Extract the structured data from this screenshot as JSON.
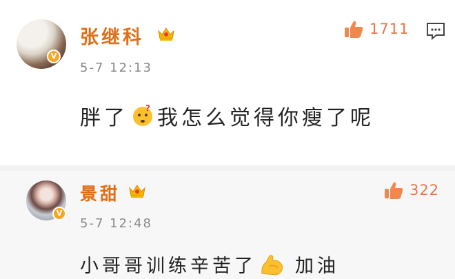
{
  "comments": [
    {
      "username": "张继科",
      "verified_badge": "V",
      "crown_icon": "vip-crown-icon",
      "timestamp": "5-7 12:13",
      "like_icon": "thumbs-up-icon",
      "like_count": "1711",
      "reply_icon": "comment-icon",
      "content_before_emoji": "胖了",
      "emoji": "thinking-face-emoji",
      "content_after_emoji": "我怎么觉得你瘦了呢"
    },
    {
      "username": "景甜",
      "verified_badge": "V",
      "crown_icon": "vip-crown-icon",
      "timestamp": "5-7 12:48",
      "like_icon": "thumbs-up-icon",
      "like_count": "322",
      "content_before_emoji": "小哥哥训练辛苦了",
      "emoji": "flexed-biceps-emoji",
      "content_after_emoji": "加油"
    }
  ],
  "colors": {
    "username": "#e06e15",
    "like_icon": "#f0884e",
    "crown": "#f5b400",
    "badge": "#f6a623",
    "second_comment_bg": "#f7f7f7"
  }
}
